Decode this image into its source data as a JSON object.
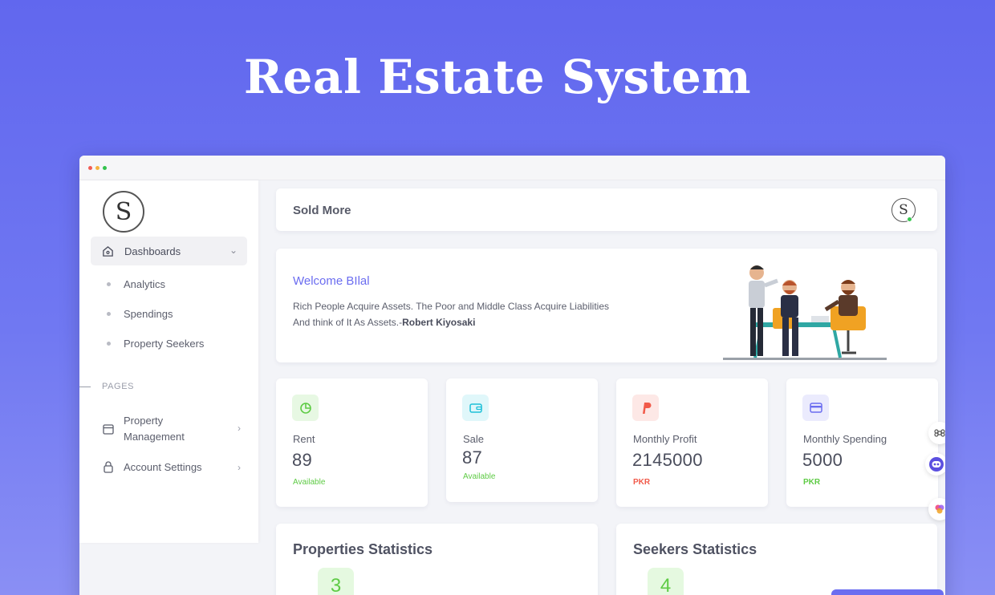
{
  "hero": {
    "title": "Real Estate System"
  },
  "logo": {
    "monogram": "S"
  },
  "sidebar": {
    "dashboards_label": "Dashboards",
    "sub_items": [
      "Analytics",
      "Spendings",
      "Property Seekers"
    ],
    "pages_label": "PAGES",
    "property_management_line1": "Property",
    "property_management_line2": "Management",
    "account_settings": "Account Settings"
  },
  "topbar": {
    "title": "Sold More",
    "avatar_monogram": "S"
  },
  "welcome": {
    "title": "Welcome BIlal",
    "quote": "Rich People Acquire Assets. The Poor and Middle Class Acquire Liabilities And think of It As Assets.-",
    "author": "Robert Kiyosaki"
  },
  "stats": [
    {
      "label": "Rent",
      "value": "89",
      "note": "Available",
      "icon": "pie-chart-icon",
      "color": "#5ecb45",
      "bg": "#e7f8e3"
    },
    {
      "label": "Sale",
      "value": "87",
      "note": "Available",
      "icon": "wallet-icon",
      "color": "#1ec0d8",
      "bg": "#e0f7fa"
    },
    {
      "label": "Monthly Profit",
      "value": "2145000",
      "note": "PKR",
      "icon": "paypal-icon",
      "color": "#f15a4a",
      "bg": "#fde8e6"
    },
    {
      "label": "Monthly Spending",
      "value": "5000",
      "note": "PKR",
      "icon": "credit-card-icon",
      "color": "#6b6df0",
      "bg": "#ebebfd"
    }
  ],
  "properties_statistics": {
    "title": "Properties Statistics",
    "count": "3"
  },
  "seekers_statistics": {
    "title": "Seekers Statistics",
    "count": "4"
  },
  "colors": {
    "accent": "#6b6df0",
    "success": "#5ecb45",
    "danger": "#f15a4a",
    "hero_bg": "#6167ee"
  }
}
